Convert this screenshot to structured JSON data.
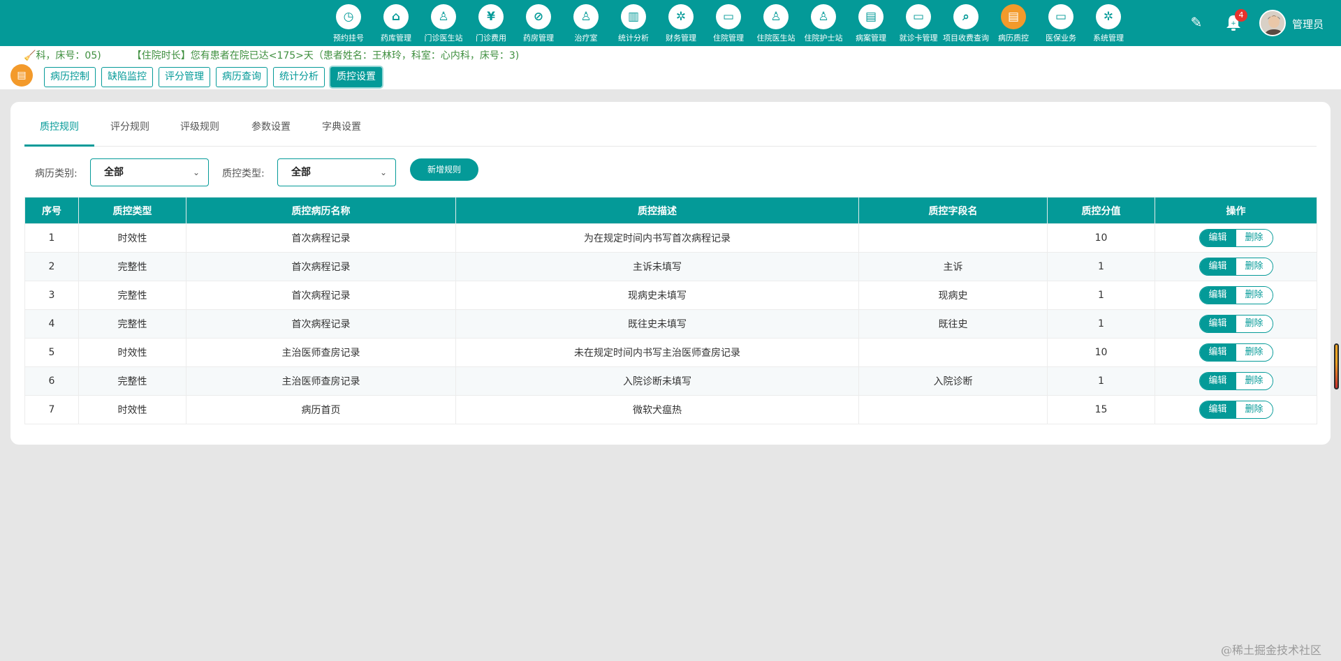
{
  "topnav": {
    "items": [
      {
        "label": "预约挂号",
        "icon": "calendar-icon",
        "glyph": "◷"
      },
      {
        "label": "药库管理",
        "icon": "warehouse-icon",
        "glyph": "⌂"
      },
      {
        "label": "门诊医生站",
        "icon": "doctor-icon",
        "glyph": "♙"
      },
      {
        "label": "门诊费用",
        "icon": "yuan-icon",
        "glyph": "¥"
      },
      {
        "label": "药房管理",
        "icon": "pill-icon",
        "glyph": "⊘"
      },
      {
        "label": "治疗室",
        "icon": "treatment-icon",
        "glyph": "♙"
      },
      {
        "label": "统计分析",
        "icon": "bar-chart-icon",
        "glyph": "▥"
      },
      {
        "label": "财务管理",
        "icon": "finance-gear-icon",
        "glyph": "✲"
      },
      {
        "label": "住院管理",
        "icon": "hospital-bed-icon",
        "glyph": "▭"
      },
      {
        "label": "住院医生站",
        "icon": "inpatient-doctor-icon",
        "glyph": "♙"
      },
      {
        "label": "住院护士站",
        "icon": "nurse-icon",
        "glyph": "♙"
      },
      {
        "label": "病案管理",
        "icon": "case-file-icon",
        "glyph": "▤"
      },
      {
        "label": "就诊卡管理",
        "icon": "card-icon",
        "glyph": "▭"
      },
      {
        "label": "项目收费查询",
        "icon": "fee-search-icon",
        "glyph": "⌕"
      },
      {
        "label": "病历质控",
        "icon": "record-qc-icon",
        "glyph": "▤"
      },
      {
        "label": "医保业务",
        "icon": "insurance-card-icon",
        "glyph": "▭"
      },
      {
        "label": "系统管理",
        "icon": "settings-icon",
        "glyph": "✲"
      }
    ],
    "active_index": 14,
    "notification_count": "4",
    "username": "管理员"
  },
  "marquee": {
    "text_a": "科，床号：05)",
    "text_b": "【住院时长】您有患者在院已达<175>天（患者姓名：王林玲，科室：心内科，床号：3)"
  },
  "module_tabs": [
    "病历控制",
    "缺陷监控",
    "评分管理",
    "病历查询",
    "统计分析",
    "质控设置"
  ],
  "module_active_index": 5,
  "card_tabs": [
    "质控规则",
    "评分规则",
    "评级规则",
    "参数设置",
    "字典设置"
  ],
  "card_active_index": 0,
  "filters": {
    "record_type_label": "病历类别:",
    "record_type_value": "全部",
    "qc_type_label": "质控类型:",
    "qc_type_value": "全部",
    "add_button": "新增规则"
  },
  "table": {
    "columns": [
      "序号",
      "质控类型",
      "质控病历名称",
      "质控描述",
      "质控字段名",
      "质控分值",
      "操作"
    ],
    "rows": [
      [
        "1",
        "时效性",
        "首次病程记录",
        "为在规定时间内书写首次病程记录",
        "",
        "10"
      ],
      [
        "2",
        "完整性",
        "首次病程记录",
        "主诉未填写",
        "主诉",
        "1"
      ],
      [
        "3",
        "完整性",
        "首次病程记录",
        "现病史未填写",
        "现病史",
        "1"
      ],
      [
        "4",
        "完整性",
        "首次病程记录",
        "既往史未填写",
        "既往史",
        "1"
      ],
      [
        "5",
        "时效性",
        "主治医师查房记录",
        "未在规定时间内书写主治医师查房记录",
        "",
        "10"
      ],
      [
        "6",
        "完整性",
        "主治医师查房记录",
        "入院诊断未填写",
        "入院诊断",
        "1"
      ],
      [
        "7",
        "时效性",
        "病历首页",
        "微软犬瘟热",
        "",
        "15"
      ]
    ],
    "edit_label": "编辑",
    "delete_label": "删除"
  },
  "watermark": "@稀土掘金技术社区"
}
